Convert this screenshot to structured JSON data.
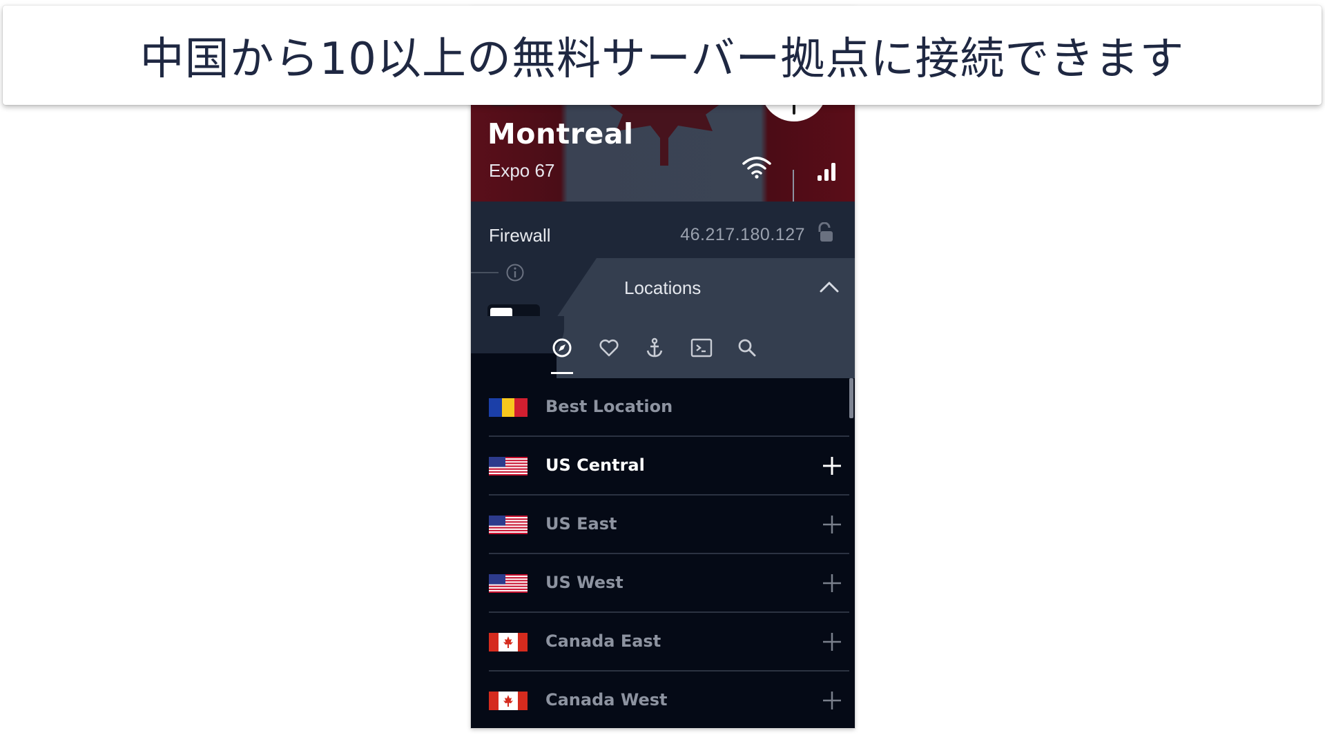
{
  "banner": {
    "text": "中国から10以上の無料サーバー拠点に接続できます"
  },
  "header": {
    "city": "Montreal",
    "server_name": "Expo 67",
    "signal_bars": 3,
    "signal_bars_total": 4
  },
  "firewall": {
    "label": "Firewall",
    "ip_address": "46.217.180.127",
    "toggle_on": false
  },
  "locations": {
    "title": "Locations",
    "tabs": [
      {
        "icon": "compass-icon",
        "selected": true
      },
      {
        "icon": "heart-icon",
        "selected": false
      },
      {
        "icon": "anchor-icon",
        "selected": false
      },
      {
        "icon": "terminal-icon",
        "selected": false
      },
      {
        "icon": "search-icon",
        "selected": false
      }
    ],
    "items": [
      {
        "label": "Best Location",
        "flag": "romania-flag-icon",
        "active": false,
        "expandable": false
      },
      {
        "label": "US Central",
        "flag": "us-flag-icon",
        "active": true,
        "expandable": true
      },
      {
        "label": "US East",
        "flag": "us-flag-icon",
        "active": false,
        "expandable": true
      },
      {
        "label": "US West",
        "flag": "us-flag-icon",
        "active": false,
        "expandable": true
      },
      {
        "label": "Canada East",
        "flag": "canada-flag-icon",
        "active": false,
        "expandable": true
      },
      {
        "label": "Canada West",
        "flag": "canada-flag-icon",
        "active": false,
        "expandable": true
      }
    ]
  },
  "colors": {
    "panel_bg": "#050a16",
    "section_bg": "#1e2738",
    "card_bg": "#343e4f",
    "hero_red": "#5a0f1a",
    "text_active": "#ffffff",
    "text_muted": "#8d93a0",
    "banner_text": "#1f2842"
  }
}
